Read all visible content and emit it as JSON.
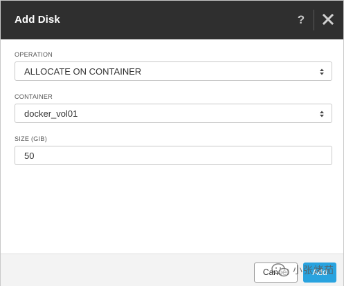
{
  "dialog": {
    "title": "Add Disk",
    "help_glyph": "?",
    "close_icon": "close-icon",
    "help_icon": "help-icon"
  },
  "form": {
    "operation": {
      "label": "OPERATION",
      "value": "ALLOCATE ON CONTAINER"
    },
    "container": {
      "label": "CONTAINER",
      "value": "docker_vol01"
    },
    "size": {
      "label": "SIZE (GIB)",
      "value": "50"
    }
  },
  "footer": {
    "cancel_label": "Cancel",
    "add_label": "Add"
  },
  "watermark": {
    "text": "小张烤茄",
    "icon": "wechat-icon"
  },
  "colors": {
    "header_bg": "#2f2f2f",
    "accent": "#29a3df"
  }
}
